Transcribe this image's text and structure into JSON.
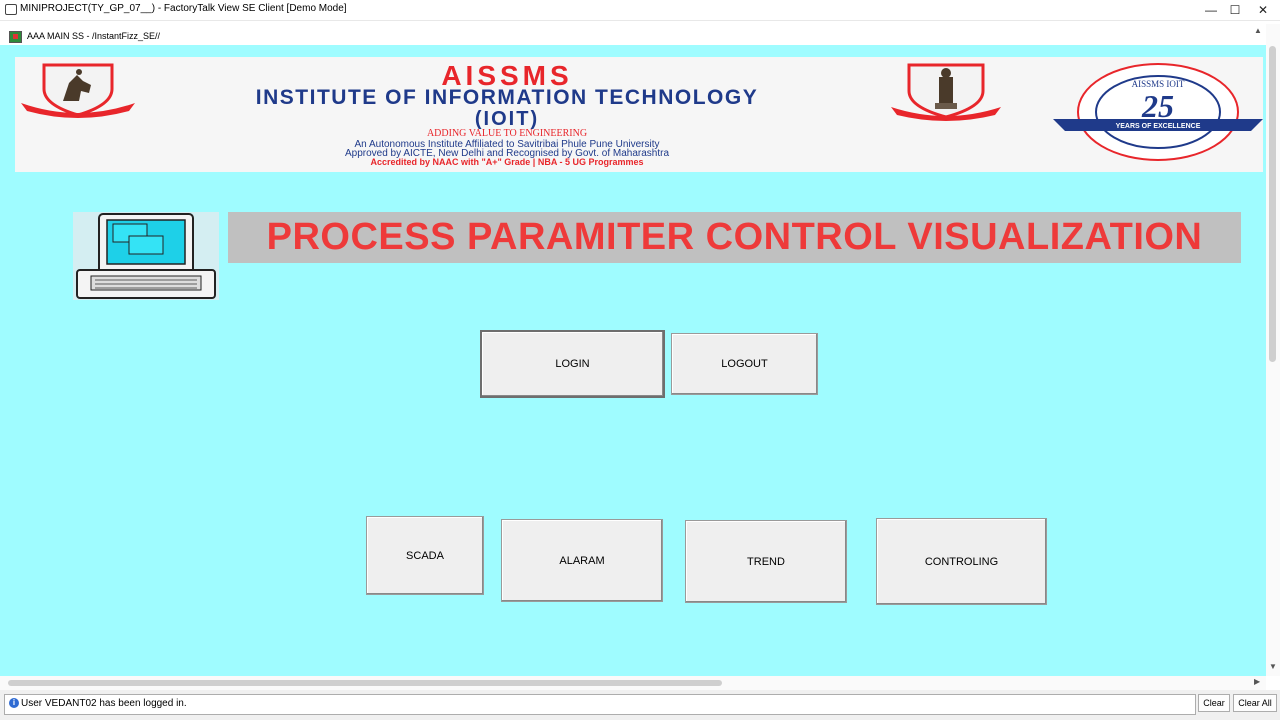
{
  "window": {
    "title": "MINIPROJECT(TY_GP_07__) - FactoryTalk View SE Client  [Demo Mode]",
    "controls": {
      "minimize": "—",
      "maximize": "☐",
      "close": "✕"
    }
  },
  "display": {
    "title": "AAA MAIN SS - /InstantFizz_SE//"
  },
  "banner": {
    "name": "AISSMS",
    "institute_line": "INSTITUTE OF INFORMATION TECHNOLOGY",
    "abbrev": "(IOIT)",
    "tagline": "ADDING VALUE TO ENGINEERING",
    "line1": "An Autonomous Institute Affiliated to Savitribai Phule Pune University",
    "line2": "Approved by AICTE, New Delhi and Recognised by Govt. of Maharashtra",
    "line3": "Accredited by NAAC with \"A+\" Grade | NBA - 5 UG Programmes",
    "badge_number": "25",
    "badge_text": "YEARS OF EXCELLENCE",
    "badge_top": "AISSMS IOIT",
    "colors": {
      "red": "#e8262b",
      "navy": "#1f3a8a"
    }
  },
  "main": {
    "heading": "PROCESS PARAMITER CONTROL VISUALIZATION",
    "buttons": {
      "login": "LOGIN",
      "logout": "LOGOUT",
      "scada": "SCADA",
      "alaram": "ALARAM",
      "trend": "TREND",
      "controling": "CONTROLING"
    },
    "background": "#9ffcff"
  },
  "status": {
    "message": "User VEDANT02 has been logged in.",
    "clear": "Clear",
    "clear_all": "Clear All"
  }
}
